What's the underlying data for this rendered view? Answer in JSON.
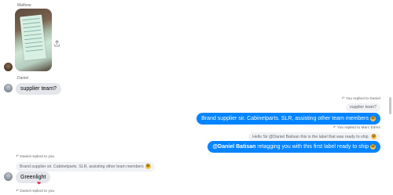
{
  "messages": {
    "photo_sender": "Mathew",
    "daniel_sender": "Daniel",
    "daniel_message": "supplier team?",
    "reply1_meta": "You replied to Daniel",
    "reply1_quote": "supplier team?",
    "reply1_text": "Brand supplier sir. Cabinetparts. SLR, assisting other team members",
    "reply1_emoji": "😁",
    "reply2_meta": "You replied to Marc Edrez",
    "reply2_quote": "Hello Sir @Daniel Batisan this is the label that was ready to ship.",
    "reply2_quote_emoji": "😀",
    "reply2_mention": "@Daniel Batisan",
    "reply2_text": " retagging you with this first label ready to ship",
    "reply2_emoji": "😀",
    "daniel_reply_meta": "Daniel replied to you",
    "daniel_reply_quote": "Brand supplier sir. Cabinetparts. SLR, assisting other team members",
    "daniel_reply_quote_emoji": "😁",
    "daniel_reply_text": "Greenlight",
    "reaction": "❤",
    "bottom_meta": "Daniel replied to you"
  },
  "icons": {
    "share": "share-icon",
    "reply_arrow": "reply-arrow-icon"
  },
  "colors": {
    "outgoing_bubble": "#0084ff",
    "incoming_bubble": "#e4e6eb",
    "quote_bubble": "#f0f2f5",
    "meta_text": "#65676b"
  }
}
